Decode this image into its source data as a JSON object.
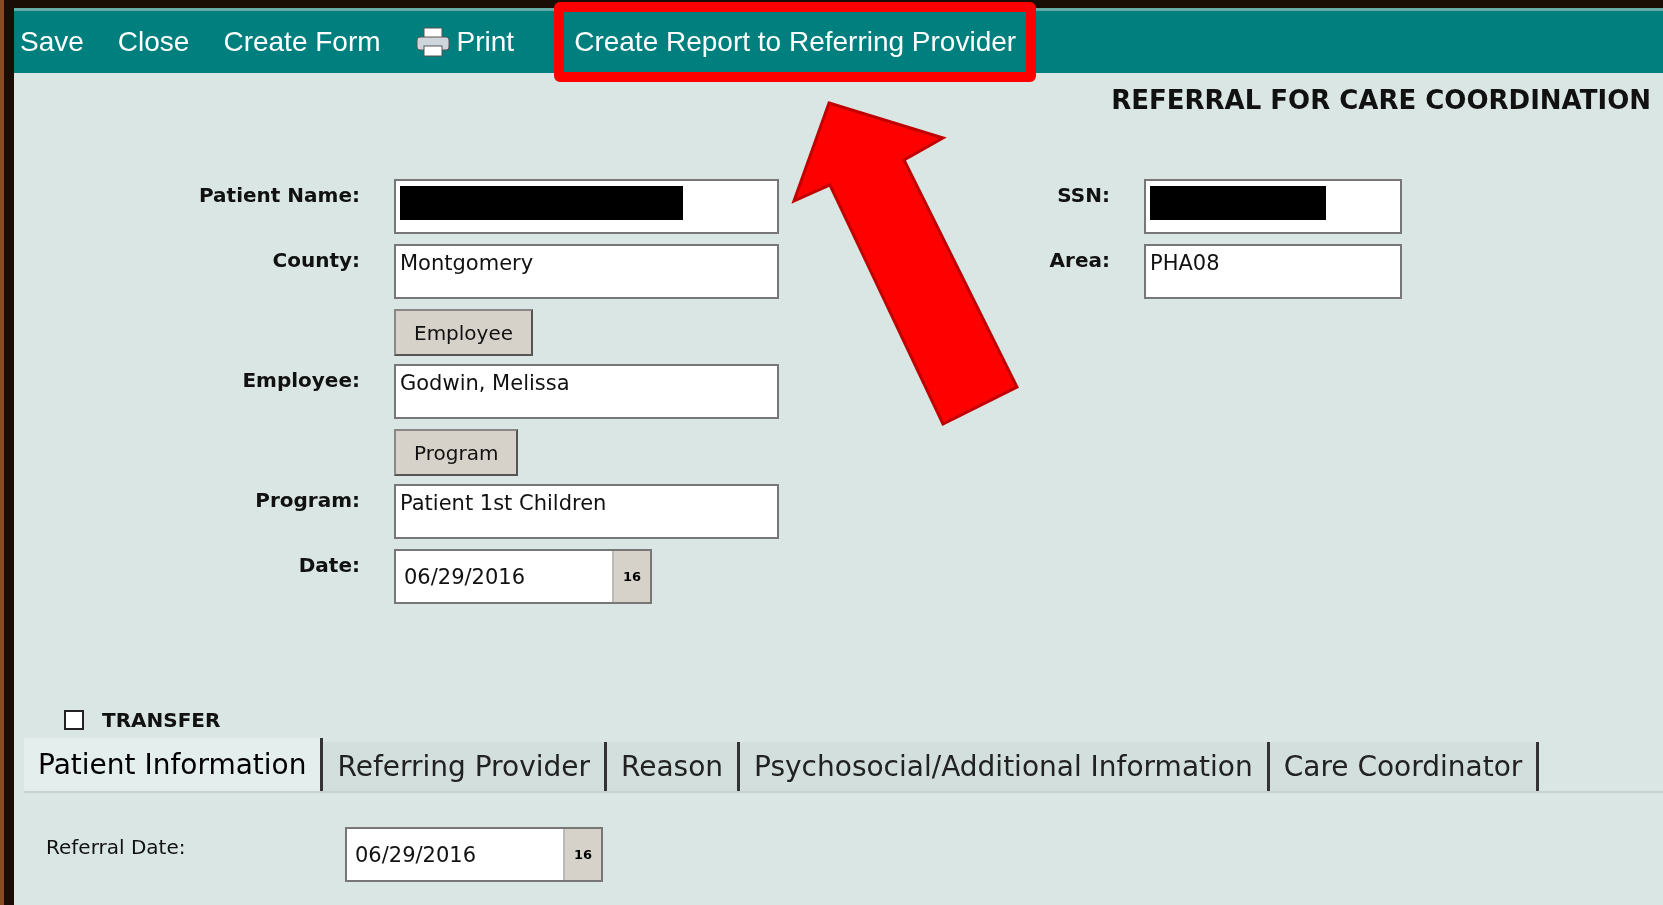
{
  "toolbar": [
    {
      "label": "Save",
      "kind": "text",
      "highlighted": false
    },
    {
      "label": "Close",
      "kind": "text",
      "highlighted": false
    },
    {
      "label": "Create Form",
      "kind": "text",
      "highlighted": false
    },
    {
      "label": "Print",
      "kind": "printer",
      "highlighted": false
    },
    {
      "label": "Create Report to Referring Provider",
      "kind": "text",
      "highlighted": true
    }
  ],
  "form_title": "REFERRAL FOR CARE COORDINATION",
  "fields": {
    "patient_name": {
      "label": "Patient Name:",
      "redacted": true
    },
    "ssn": {
      "label": "SSN:",
      "redacted": true
    },
    "county": {
      "label": "County:",
      "value": "Montgomery"
    },
    "area": {
      "label": "Area:",
      "value": "PHA08"
    },
    "employee_button": "Employee",
    "employee": {
      "label": "Employee:",
      "value": "Godwin, Melissa"
    },
    "program_button": "Program",
    "program": {
      "label": "Program:",
      "value": "Patient 1st Children"
    },
    "date": {
      "label": "Date:",
      "value": "06/29/2016",
      "calendar": "16"
    }
  },
  "transfer": {
    "label": "TRANSFER",
    "checked": false
  },
  "tabs": [
    {
      "label": "Patient Information",
      "selected": true
    },
    {
      "label": "Referring Provider",
      "selected": false
    },
    {
      "label": "Reason",
      "selected": false
    },
    {
      "label": "Psychosocial/Additional Information",
      "selected": false
    },
    {
      "label": "Care Coordinator",
      "selected": false
    }
  ],
  "referral_date": {
    "label": "Referral Date:",
    "value": "06/29/2016",
    "calendar": "16"
  }
}
